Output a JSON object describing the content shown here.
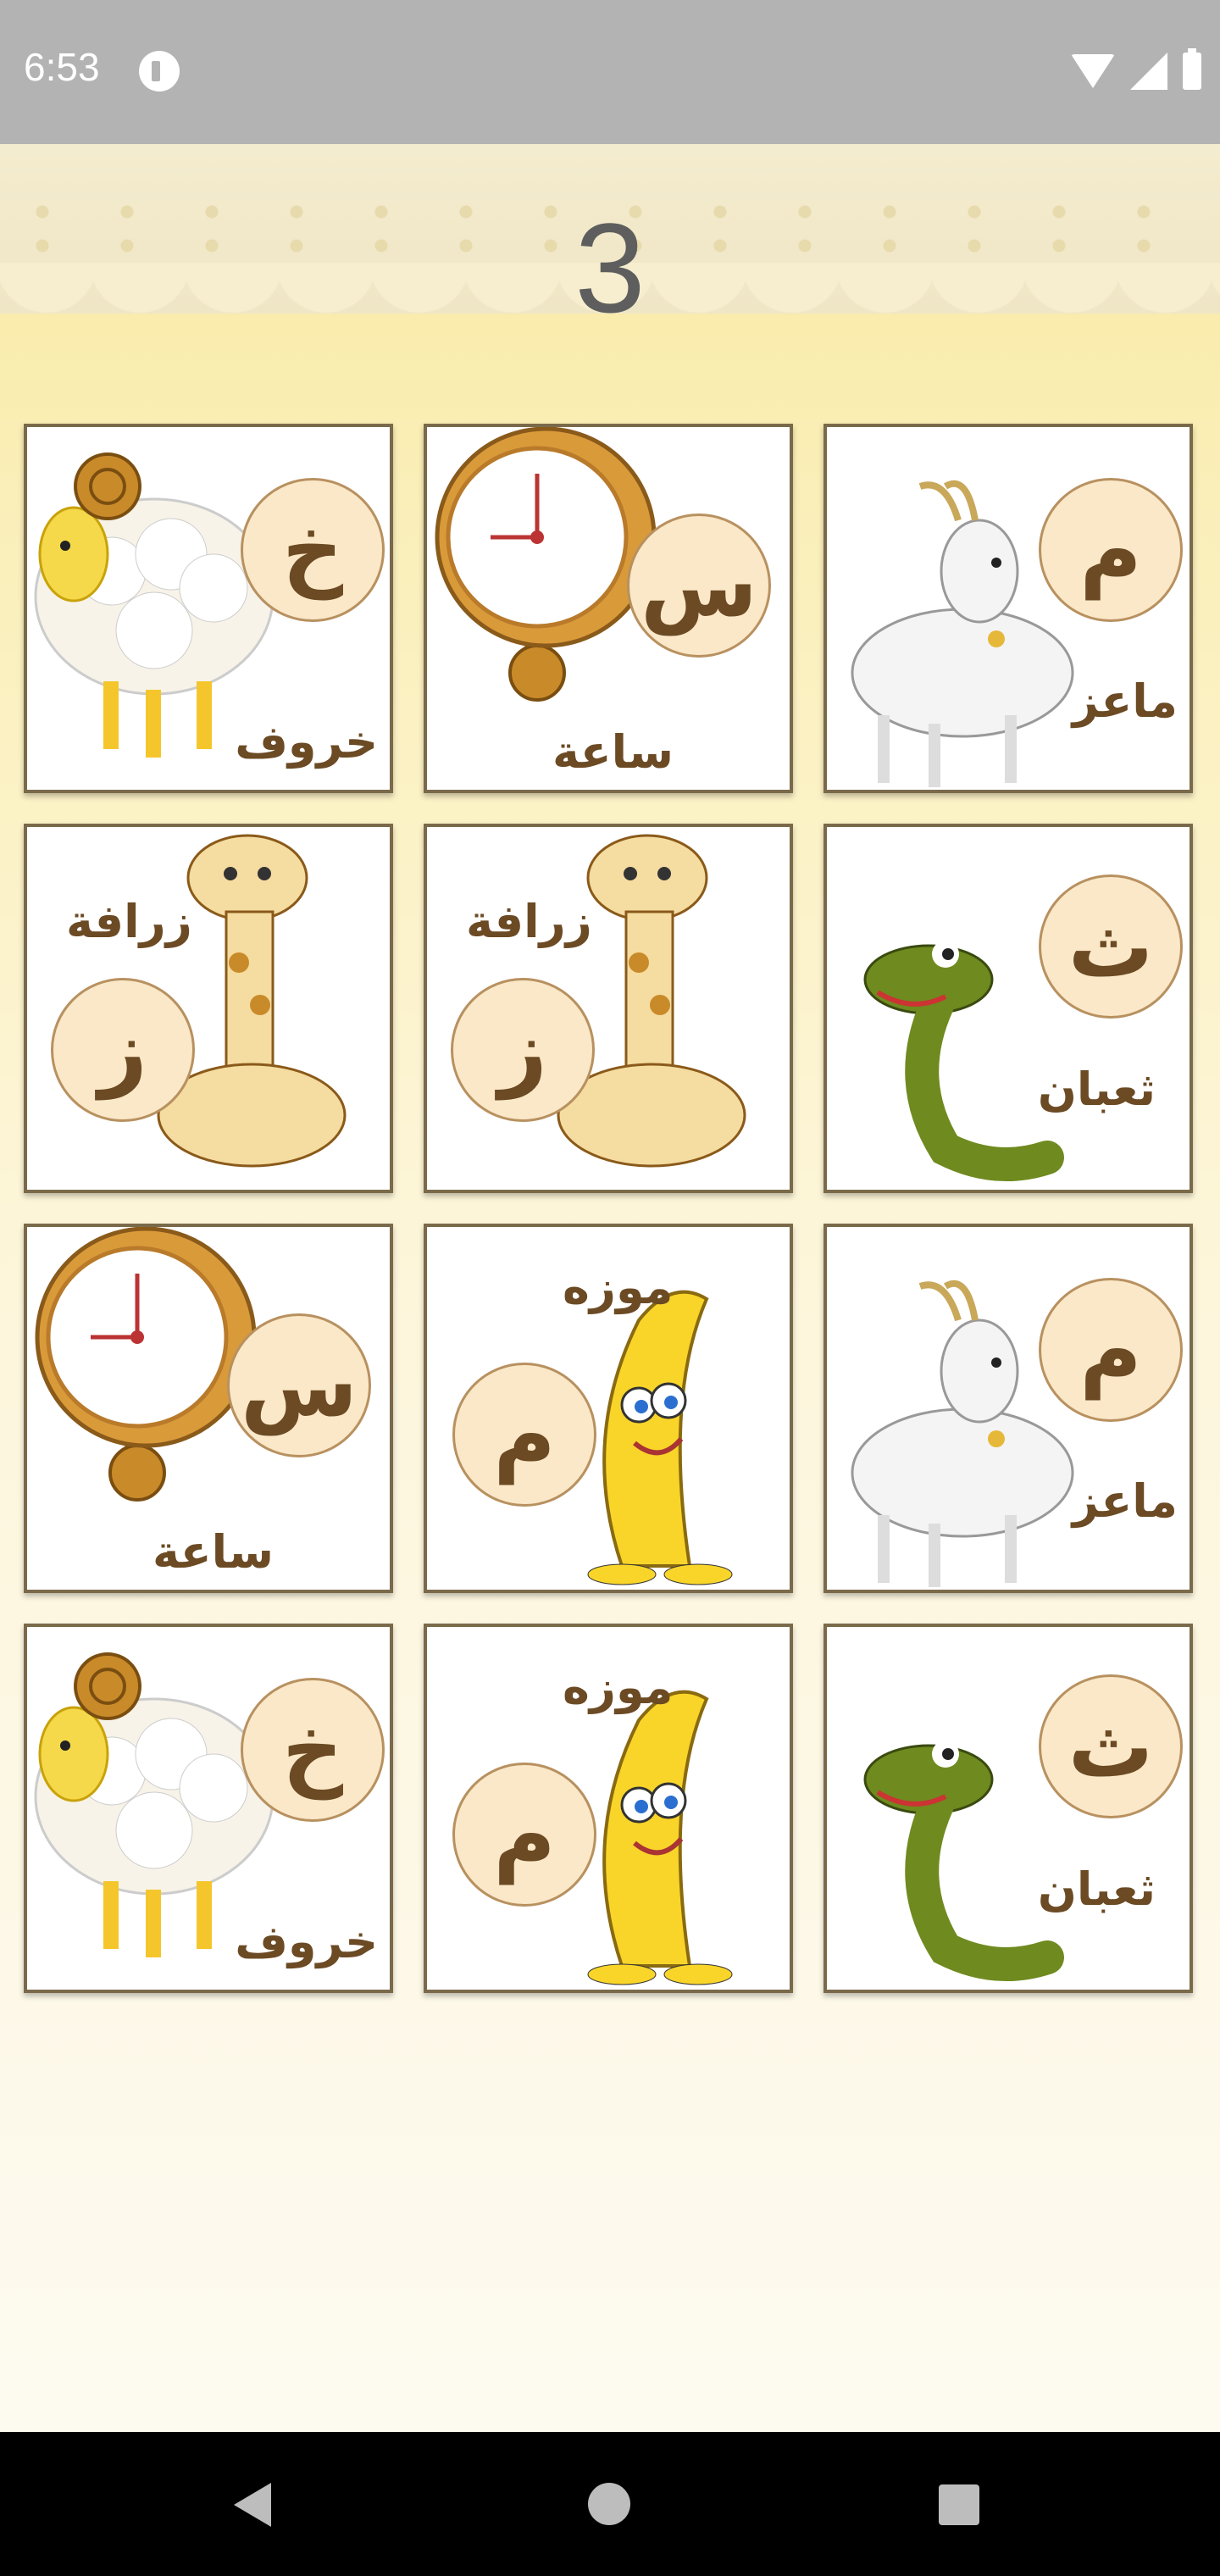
{
  "status_bar": {
    "time": "6:53"
  },
  "game": {
    "counter": "3",
    "cards": [
      {
        "row": 1,
        "col": 1,
        "letter": "خ",
        "word": "خروف",
        "picture": "sheep-icon"
      },
      {
        "row": 1,
        "col": 2,
        "letter": "س",
        "word": "ساعة",
        "picture": "clock-icon"
      },
      {
        "row": 1,
        "col": 3,
        "letter": "م",
        "word": "ماعز",
        "picture": "goat-icon"
      },
      {
        "row": 2,
        "col": 1,
        "letter": "ز",
        "word": "زرافة",
        "picture": "giraffe-icon"
      },
      {
        "row": 2,
        "col": 2,
        "letter": "ز",
        "word": "زرافة",
        "picture": "giraffe-icon"
      },
      {
        "row": 2,
        "col": 3,
        "letter": "ث",
        "word": "ثعبان",
        "picture": "snake-icon"
      },
      {
        "row": 3,
        "col": 1,
        "letter": "س",
        "word": "ساعة",
        "picture": "clock-icon"
      },
      {
        "row": 3,
        "col": 2,
        "letter": "م",
        "word": "موزه",
        "picture": "banana-icon"
      },
      {
        "row": 3,
        "col": 3,
        "letter": "م",
        "word": "ماعز",
        "picture": "goat-icon"
      },
      {
        "row": 4,
        "col": 1,
        "letter": "خ",
        "word": "خروف",
        "picture": "sheep-icon"
      },
      {
        "row": 4,
        "col": 2,
        "letter": "م",
        "word": "موزه",
        "picture": "banana-icon"
      },
      {
        "row": 4,
        "col": 3,
        "letter": "ث",
        "word": "ثعبان",
        "picture": "snake-icon"
      }
    ]
  },
  "nav_bar": {
    "icons": [
      "back-icon",
      "home-icon",
      "recents-icon"
    ]
  }
}
